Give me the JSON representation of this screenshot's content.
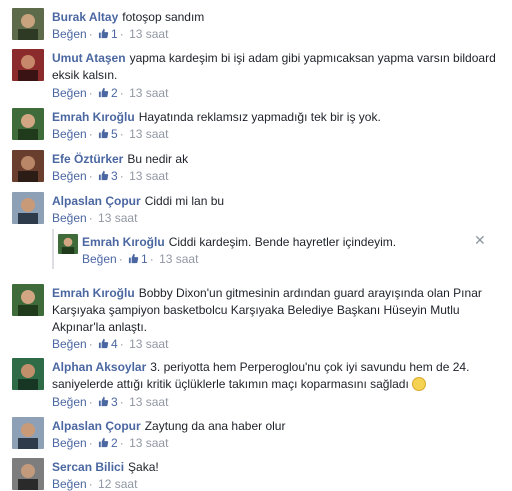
{
  "comments": [
    {
      "author": "Burak Altay",
      "text": "fotoşop sandım",
      "like": "Beğen",
      "count": "1",
      "time": "13 saat"
    },
    {
      "author": "Umut Ataşen",
      "text": "yapma kardeşim bi işi adam gibi yapmıcaksan yapma varsın bildoard eksik kalsın.",
      "like": "Beğen",
      "count": "2",
      "time": "13 saat"
    },
    {
      "author": "Emrah Kıroğlu",
      "text": "Hayatında reklamsız yapmadığı tek bir iş yok.",
      "like": "Beğen",
      "count": "5",
      "time": "13 saat"
    },
    {
      "author": "Efe Öztürker",
      "text": "Bu nedir ak",
      "like": "Beğen",
      "count": "3",
      "time": "13 saat"
    },
    {
      "author": "Alpaslan Çopur",
      "text": "Ciddi mi lan bu",
      "like": "Beğen",
      "count": "",
      "time": "13 saat"
    },
    {
      "author": "Emrah Kıroğlu",
      "text": "Ciddi kardeşim. Bende hayretler içindeyim.",
      "like": "Beğen",
      "count": "1",
      "time": "13 saat"
    },
    {
      "author": "Emrah Kıroğlu",
      "text": "Bobby Dixon'un gitmesinin ardından guard arayışında olan Pınar Karşıyaka şampiyon basketbolcu Karşıyaka Belediye Başkanı Hüseyin Mutlu Akpınar'la anlaştı.",
      "like": "Beğen",
      "count": "4",
      "time": "13 saat"
    },
    {
      "author": "Alphan Aksoylar",
      "text": "3. periyotta hem Perperoglou'nu çok iyi savundu hem de 24. saniyelerde attığı kritik üçlüklerle takımın maçı koparmasını sağladı",
      "like": "Beğen",
      "count": "3",
      "time": "13 saat"
    },
    {
      "author": "Alpaslan Çopur",
      "text": "Zaytung da ana haber olur",
      "like": "Beğen",
      "count": "2",
      "time": "13 saat"
    },
    {
      "author": "Sercan Bilici",
      "text": "Şaka!",
      "like": "Beğen",
      "count": "",
      "time": "12 saat"
    }
  ],
  "icons": {
    "like_count": "thumbs-up-icon",
    "emoji": "smile-emoji-icon",
    "remove": "close-icon"
  },
  "colors": {
    "author": "#4b67a1",
    "meta": "#9197a3",
    "text": "#1d2129"
  }
}
